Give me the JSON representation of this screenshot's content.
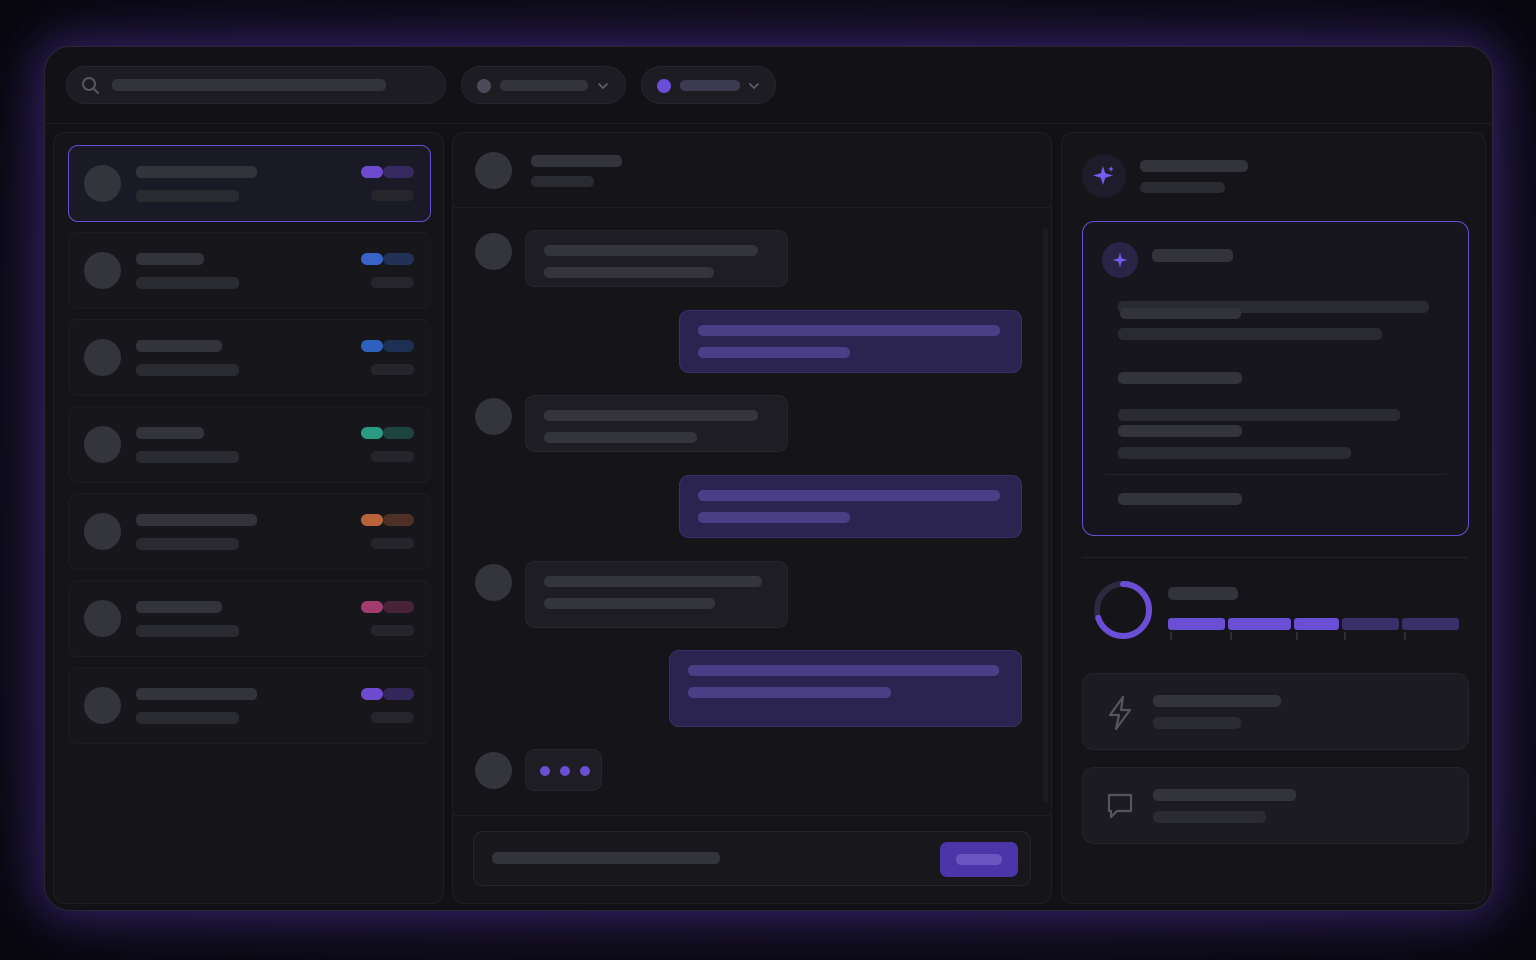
{
  "colors": {
    "accent": "#6a4fd6",
    "accent_soft": "#2b2450",
    "tag_purple": "#6d4ad0",
    "tag_blue": "#3a63c9",
    "tag_blue2": "#2f5fbf",
    "tag_teal": "#2a9a82",
    "tag_orange": "#b8623a",
    "tag_pink": "#a03d6e",
    "background": "#111116"
  },
  "icons": {
    "search": "search-icon",
    "chevron": "chevron-down-icon",
    "sparkle": "sparkle-icon",
    "bolt": "lightning-icon",
    "chat": "chat-bubble-icon"
  },
  "conversations": [
    {
      "tag_color": "tag_purple",
      "active": true
    },
    {
      "tag_color": "tag_blue",
      "active": false
    },
    {
      "tag_color": "tag_blue2",
      "active": false
    },
    {
      "tag_color": "tag_teal",
      "active": false
    },
    {
      "tag_color": "tag_orange",
      "active": false
    },
    {
      "tag_color": "tag_pink",
      "active": false
    },
    {
      "tag_color": "tag_purple",
      "active": false
    }
  ],
  "messages": [
    {
      "direction": "incoming"
    },
    {
      "direction": "outgoing"
    },
    {
      "direction": "incoming"
    },
    {
      "direction": "outgoing"
    },
    {
      "direction": "incoming"
    },
    {
      "direction": "outgoing"
    }
  ],
  "typing_indicator": true,
  "progress": {
    "ring_fraction": 0.7,
    "segments_filled": 3,
    "segments_total": 5
  }
}
